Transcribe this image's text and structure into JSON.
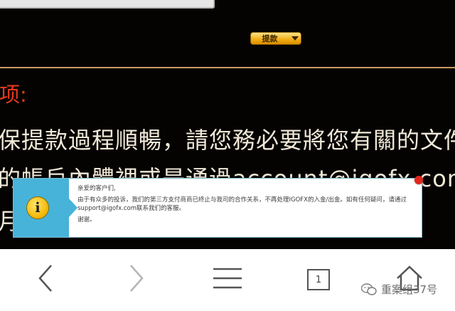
{
  "page": {
    "withdraw_select_label": "提款",
    "notice_heading": "项:",
    "notice_line1": "保提款過程順暢，請您務必要將您有關的文件",
    "notice_line2": "的帳戶內體裡或是通過account@igofx.com來",
    "notice_line3": "月"
  },
  "dialog": {
    "greeting": "亲爱的客户们,",
    "body": "由于有众多的投诉，我们的第三方支付商商已终止与我司的合作关系，不再处理IGOFX的入金/出金。如有任何疑问，请通过support@igofx.com联系我们的客服。",
    "closing": "谢谢。",
    "icon_glyph": "i"
  },
  "toolbar": {
    "back_icon": "chevron-left-icon",
    "forward_icon": "chevron-right-icon",
    "menu_icon": "hamburger-menu-icon",
    "tab_count": "1",
    "home_icon": "home-icon"
  },
  "watermark": {
    "text": "重案组37号"
  },
  "colors": {
    "page_background": "#050302",
    "heading_red": "#e53a1c",
    "notice_text": "#f0e8d8",
    "dialog_accent": "#47b3d8",
    "divider_gold": "#c99a62",
    "close_red": "#e3261c"
  }
}
